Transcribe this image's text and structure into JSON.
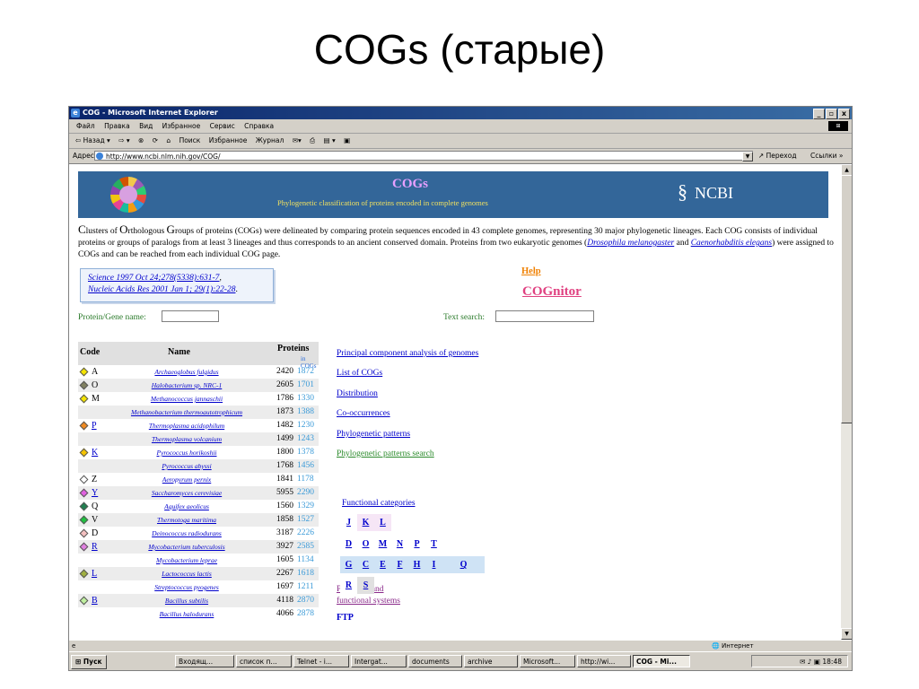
{
  "slide": {
    "title": "COGs (старые)"
  },
  "window": {
    "title": "COG - Microsoft Internet Explorer",
    "controls": [
      "_",
      "8",
      "x"
    ],
    "menu": [
      "Файл",
      "Правка",
      "Вид",
      "Избранное",
      "Сервис",
      "Справка"
    ],
    "toolbar": [
      "⇦ Назад ▾",
      "⇨ ▾",
      "⊗",
      "⟳",
      "⌂",
      "Поиск",
      "Избранное",
      "Журнал",
      "✉▾",
      "⎙",
      "▤ ▾",
      "▣"
    ],
    "address_label": "Адрес",
    "address": "http://www.ncbi.nlm.nih.gov/COG/",
    "go": "Переход",
    "links": "Ссылки »",
    "status_zone": "Интернет"
  },
  "page": {
    "banner": {
      "title": "COGs",
      "subtitle": "Phylogenetic classification of proteins encoded in complete genomes",
      "ncbi": "NCBI",
      "ncbi_symbol": "§"
    },
    "intro": {
      "c1": "C",
      "w1": "lusters of ",
      "c2": "O",
      "w2": "rthologous ",
      "c3": "G",
      "w3": "roups of proteins (COGs) were delineated by comparing protein sequences encoded in 43 complete genomes, representing 30 major phylogenetic lineages. Each COG consists of individual proteins or groups of paralogs from at least 3 lineages and thus corresponds to an ancient conserved domain. Proteins from two eukaryotic genomes (",
      "link1": "Drosophila melanogaster",
      "and": " and ",
      "link2": "Caenorhabditis elegans",
      "tail": ") were assigned to COGs and can be reached from each individual COG page."
    },
    "refs": {
      "science_journal": "Science",
      "science_ref": " 1997 Oct 24;278(5338):631-7",
      "nar_journal": "Nucleic Acids Res",
      "nar_ref": " 2001 Jan 1; 29(1):22-28"
    },
    "help": "Help",
    "cognitor": "COGnitor",
    "protein_label": "Protein/Gene name:",
    "text_label": "Text search:",
    "table": {
      "headers": {
        "code": "Code",
        "name": "Name",
        "proteins": "Proteins",
        "in_cogs": "in COGs"
      },
      "rows": [
        {
          "code": "A",
          "color": "#f5e400",
          "name": "Archaeoglobus fulgidus",
          "proteins": "2420",
          "in_cogs": "1872",
          "link": false
        },
        {
          "code": "O",
          "color": "#808060",
          "name": "Halobacterium sp. NRC-1",
          "proteins": "2605",
          "in_cogs": "1701",
          "link": false
        },
        {
          "code": "M",
          "color": "#f5e400",
          "name": "Methanococcus jannaschii",
          "proteins": "1786",
          "in_cogs": "1330",
          "link": false
        },
        {
          "code": "",
          "color": "",
          "name": "Methanobacterium thermoautotrophicum",
          "proteins": "1873",
          "in_cogs": "1388",
          "link": false
        },
        {
          "code": "P",
          "color": "#f08a20",
          "name": "Thermoplasma acidophilum",
          "proteins": "1482",
          "in_cogs": "1230",
          "link": true
        },
        {
          "code": "",
          "color": "",
          "name": "Thermoplasma volcanium",
          "proteins": "1499",
          "in_cogs": "1243",
          "link": false
        },
        {
          "code": "K",
          "color": "#f5c400",
          "name": "Pyrococcus horikoshii",
          "proteins": "1800",
          "in_cogs": "1378",
          "link": true
        },
        {
          "code": "",
          "color": "",
          "name": "Pyrococcus abyssi",
          "proteins": "1768",
          "in_cogs": "1456",
          "link": false
        },
        {
          "code": "Z",
          "color": "#ffffff",
          "name": "Aeropyrum pernix",
          "proteins": "1841",
          "in_cogs": "1178",
          "link": false
        },
        {
          "code": "Y",
          "color": "#e060e0",
          "name": "Saccharomyces cerevisiae",
          "proteins": "5955",
          "in_cogs": "2290",
          "link": true
        },
        {
          "code": "Q",
          "color": "#208050",
          "name": "Aquifex aeolicus",
          "proteins": "1560",
          "in_cogs": "1329",
          "link": false
        },
        {
          "code": "V",
          "color": "#20c040",
          "name": "Thermotoga maritima",
          "proteins": "1858",
          "in_cogs": "1527",
          "link": false
        },
        {
          "code": "D",
          "color": "#f4c0c0",
          "name": "Deinococcus radiodurans",
          "proteins": "3187",
          "in_cogs": "2226",
          "link": false
        },
        {
          "code": "R",
          "color": "#e080e0",
          "name": "Mycobacterium tuberculosis",
          "proteins": "3927",
          "in_cogs": "2585",
          "link": true
        },
        {
          "code": "",
          "color": "",
          "name": "Mycobacterium leprae",
          "proteins": "1605",
          "in_cogs": "1134",
          "link": false
        },
        {
          "code": "L",
          "color": "#a0b040",
          "name": "Lactococcus lactis",
          "proteins": "2267",
          "in_cogs": "1618",
          "link": true
        },
        {
          "code": "",
          "color": "",
          "name": "Streptococcus pyogenes",
          "proteins": "1697",
          "in_cogs": "1211",
          "link": false
        },
        {
          "code": "B",
          "color": "#c0f0a0",
          "name": "Bacillus subtilis",
          "proteins": "4118",
          "in_cogs": "2870",
          "link": true
        },
        {
          "code": "",
          "color": "",
          "name": "Bacillus halodurans",
          "proteins": "4066",
          "in_cogs": "2878",
          "link": false
        }
      ]
    },
    "right_links": {
      "pca": "Principal component analysis of genomes",
      "list": "List of COGs",
      "distribution": "Distribution",
      "cooccur": "Co-occurrences",
      "patterns": "Phylogenetic patterns",
      "patterns_search": "Phylogenetic patterns search",
      "functional": "Functional categories",
      "pathways1": "Pathways and",
      "pathways2": "functional systems",
      "ftp": "FTP"
    },
    "letters": {
      "row1": [
        "J",
        "K",
        "L"
      ],
      "row2": [
        "D",
        "O",
        "M",
        "N",
        "P",
        "T"
      ],
      "row3": [
        "G",
        "C",
        "E",
        "F",
        "H",
        "I",
        "Q"
      ],
      "row4": [
        "R",
        "S"
      ]
    }
  },
  "taskbar": {
    "start": "Пуск",
    "tasks": [
      "Входящ...",
      "список п...",
      "Telnet - i...",
      "Intergat...",
      "documents",
      "archive",
      "Microsoft...",
      "http://wi...",
      "COG - Mi..."
    ],
    "clock": "18:48"
  }
}
